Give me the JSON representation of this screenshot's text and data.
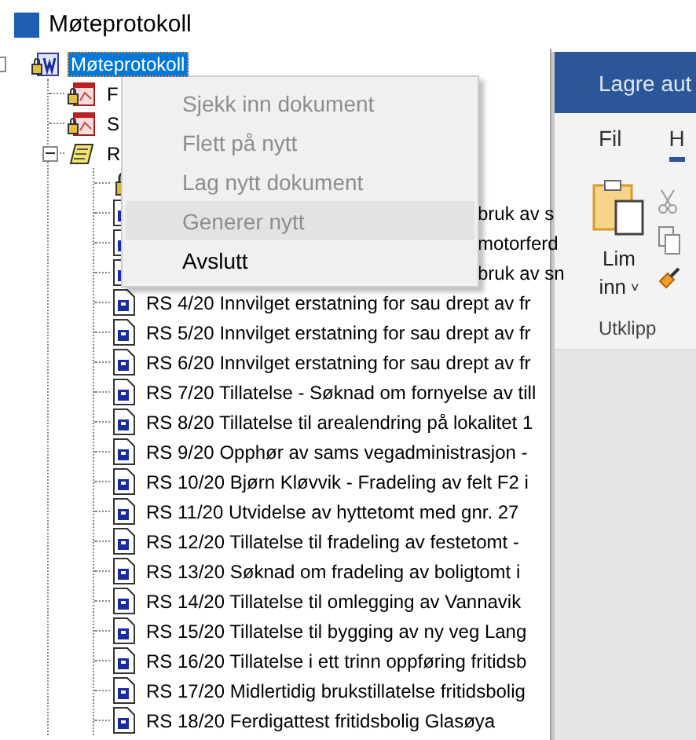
{
  "app": {
    "title": "Møteprotokoll"
  },
  "tree": {
    "label": "Møteprotokoll",
    "kind": "word-lock",
    "selected": true,
    "expanded": true,
    "covered": false,
    "children": [
      {
        "label": "F",
        "kind": "pdf-lock",
        "selected": false,
        "covered": false
      },
      {
        "label": "S",
        "kind": "pdf-lock",
        "selected": false,
        "covered": false
      },
      {
        "label": "R",
        "kind": "scroll",
        "selected": false,
        "expanded": true,
        "covered": false,
        "children": [
          {
            "kind": "lock",
            "selected": false
          },
          {
            "label": "bruk av s",
            "kind": "doc",
            "selected": false,
            "covered": true
          },
          {
            "label": "motorferd",
            "kind": "doc",
            "selected": false,
            "covered": true
          },
          {
            "label": "bruk av sn",
            "kind": "doc",
            "selected": false,
            "covered": true
          },
          {
            "label": "RS 4/20 Innvilget erstatning for sau drept av fr",
            "kind": "doc",
            "selected": false,
            "covered": false
          },
          {
            "label": "RS 5/20 Innvilget erstatning for sau drept av fr",
            "kind": "doc",
            "selected": false,
            "covered": false
          },
          {
            "label": "RS 6/20 Innvilget erstatning for sau drept av fr",
            "kind": "doc",
            "selected": false,
            "covered": false
          },
          {
            "label": "RS 7/20 Tillatelse - Søknad om fornyelse av till",
            "kind": "doc",
            "selected": false,
            "covered": false
          },
          {
            "label": "RS 8/20 Tillatelse til arealendring på lokalitet 1",
            "kind": "doc",
            "selected": false,
            "covered": false
          },
          {
            "label": "RS 9/20 Opphør av sams vegadministrasjon -",
            "kind": "doc",
            "selected": false,
            "covered": false
          },
          {
            "label": "RS 10/20 Bjørn Kløvvik - Fradeling av felt F2 i",
            "kind": "doc",
            "selected": false,
            "covered": false
          },
          {
            "label": "RS 11/20 Utvidelse av hyttetomt med gnr. 27",
            "kind": "doc",
            "selected": false,
            "covered": false
          },
          {
            "label": "RS 12/20 Tillatelse til fradeling av festetomt -",
            "kind": "doc",
            "selected": false,
            "covered": false
          },
          {
            "label": "RS 13/20 Søknad om fradeling av boligtomt i",
            "kind": "doc",
            "selected": false,
            "covered": false
          },
          {
            "label": "RS 14/20 Tillatelse til omlegging av Vannavik",
            "kind": "doc",
            "selected": false,
            "covered": false
          },
          {
            "label": "RS 15/20 Tillatelse til bygging av ny veg Lang",
            "kind": "doc",
            "selected": false,
            "covered": false
          },
          {
            "label": "RS 16/20 Tillatelse i ett trinn  oppføring fritidsb",
            "kind": "doc",
            "selected": false,
            "covered": false
          },
          {
            "label": "RS 17/20 Midlertidig brukstillatelse fritidsbolig",
            "kind": "doc",
            "selected": false,
            "covered": false
          },
          {
            "label": "RS 18/20 Ferdigattest fritidsbolig Glasøya",
            "kind": "doc",
            "selected": false,
            "covered": false
          }
        ]
      }
    ]
  },
  "context_menu": {
    "items": [
      {
        "label": "Sjekk inn dokument",
        "disabled": true,
        "highlighted": false
      },
      {
        "label": "Flett på nytt",
        "disabled": true,
        "highlighted": false
      },
      {
        "label": "Lag nytt dokument",
        "disabled": true,
        "highlighted": false
      },
      {
        "label": "Generer nytt",
        "disabled": true,
        "highlighted": true
      },
      {
        "label": "Avslutt",
        "disabled": false,
        "highlighted": false
      }
    ]
  },
  "word": {
    "title": "Lagre aut",
    "tabs": [
      {
        "label": "Fil",
        "selected": false
      },
      {
        "label": "H",
        "selected": true
      }
    ],
    "paste_label": "Lim",
    "paste_label_2": "inn",
    "paste_caret": "˅",
    "group_label": "Utklipp"
  }
}
